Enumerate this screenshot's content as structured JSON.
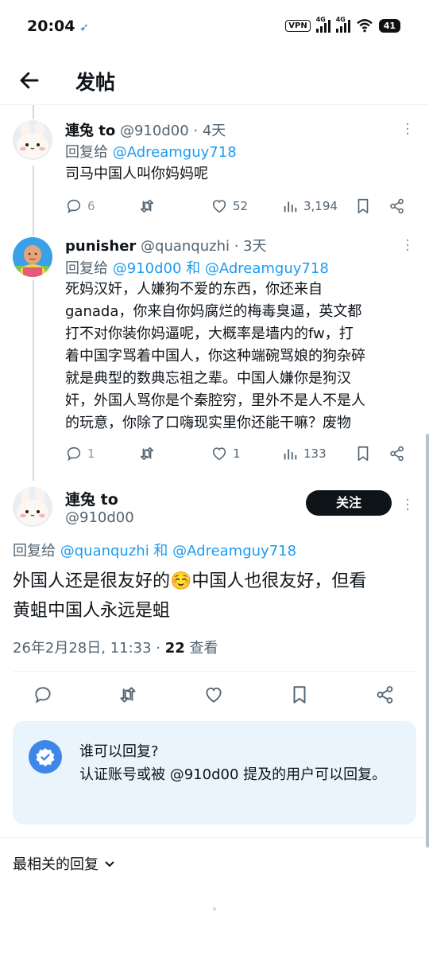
{
  "status_bar": {
    "time": "20:04",
    "vpn": "VPN",
    "signal1": "4G",
    "signal2": "4G",
    "battery": "41"
  },
  "header": {
    "title": "发帖"
  },
  "replies": [
    {
      "name": "連兔 to",
      "handle": "@910d00",
      "time": "· 4天",
      "reply_prefix": "回复给",
      "reply_targets": "@Adreamguy718",
      "text": "司马中国人叫你妈妈呢",
      "stats": {
        "replies": "6",
        "reposts": "",
        "likes": "52",
        "views": "3,194"
      }
    },
    {
      "name": "punisher",
      "handle": "@quanquzhi",
      "time": "· 3天",
      "reply_prefix": "回复给",
      "reply_targets": "@910d00 和 @Adreamguy718",
      "text_lines": [
        "死妈汉奸，人嫌狗不爱的东西，你还来自",
        "ganada，你来自你妈腐烂的梅毒臭逼，英文都",
        "打不对你装你妈逼呢，大概率是墙内的fw，打",
        "着中国字骂着中国人，你这种端碗骂娘的狗杂碎",
        "就是典型的数典忘祖之辈。中国人嫌你是狗汉",
        "奸，外国人骂你是个秦腔穷，里外不是人不是人",
        "的玩意，你除了口嗨现实里你还能干嘛？废物"
      ],
      "stats": {
        "replies": "1",
        "reposts": "",
        "likes": "1",
        "views": "133"
      }
    }
  ],
  "main_tweet": {
    "name": "連兔 to",
    "handle": "@910d00",
    "follow_label": "关注",
    "reply_prefix": "回复给",
    "reply_targets": "@quanquzhi 和 @Adreamguy718",
    "text_line1": "外国人还是很友好的☺️中国人也很友好，但看",
    "text_line2": "黄蛆中国人永远是蛆",
    "date": "26年2月28日, 11:33 · ",
    "views_count": "22",
    "views_label": " 查看"
  },
  "reply_restriction": {
    "title": "谁可以回复?",
    "body": "认证账号或被 @910d00 提及的用户可以回复。"
  },
  "sort": {
    "label": "最相关的回复"
  }
}
